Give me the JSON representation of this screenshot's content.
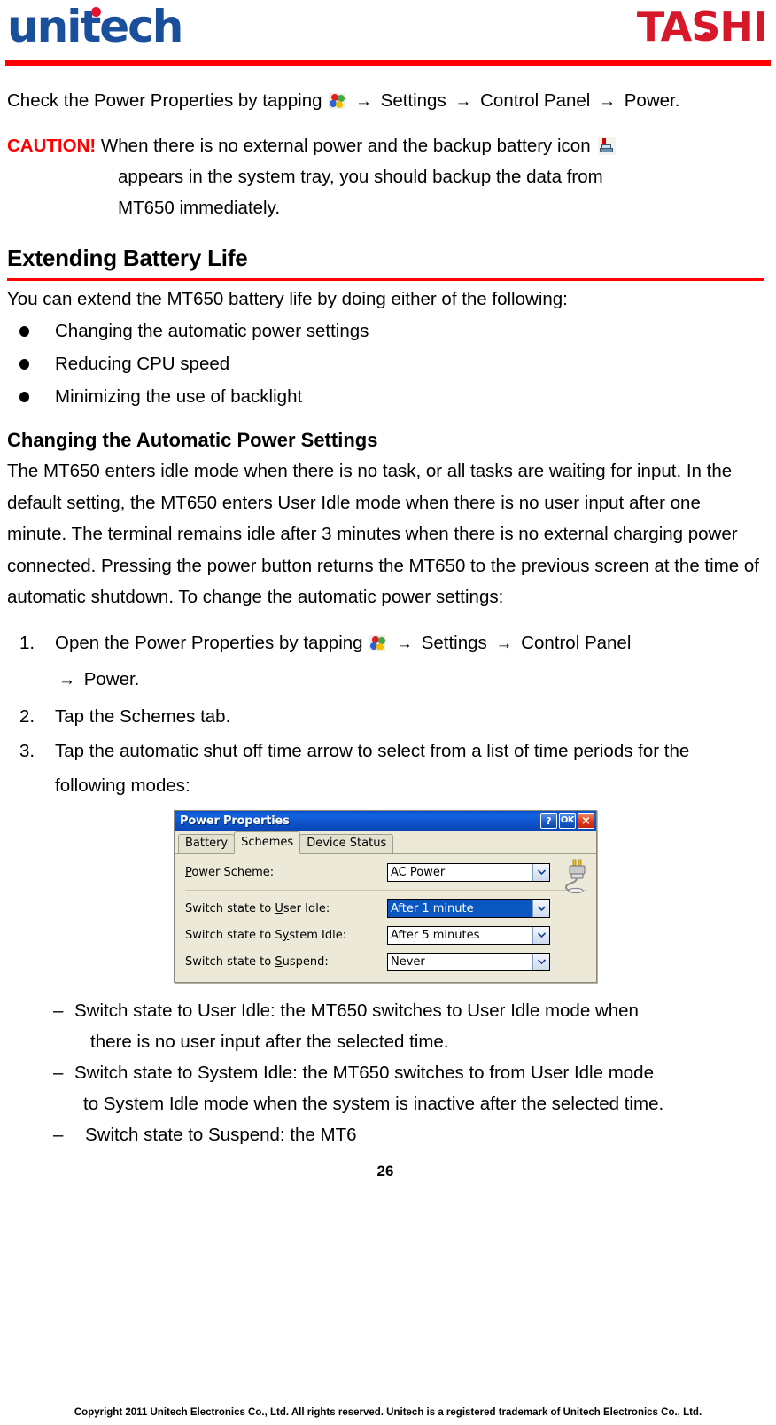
{
  "header": {
    "logo_left": "unitech",
    "logo_right": "TASHI"
  },
  "intro": {
    "text_before_icon": "Check the Power Properties by tapping",
    "start_icon": "windows-start-icon",
    "arrow": "→",
    "menu_settings": "Settings",
    "menu_control_panel": "Control Panel",
    "menu_power": "Power."
  },
  "caution": {
    "label": "CAUTION!",
    "line1": "When there is no external power and the backup battery icon",
    "battery_icon": "backup-battery-warning-icon",
    "line2": "appears in the system tray, you should backup the data from",
    "line3": "MT650 immediately."
  },
  "section": {
    "title": "Extending Battery Life",
    "intro": "You can extend the MT650 battery life by doing either of the following:",
    "bullets": [
      "Changing the automatic power settings",
      "Reducing CPU speed",
      "Minimizing the use of backlight"
    ]
  },
  "subsection": {
    "title": "Changing the Automatic Power Settings",
    "paragraph": "The MT650 enters idle mode when there is no task, or all tasks are waiting for input. In the default setting, the MT650 enters User Idle mode when there is no user input after one minute. The terminal remains idle after 3 minutes when there is no external charging power connected. Pressing the power button returns the MT650 to the previous screen at the time of automatic shutdown. To change the automatic power settings:"
  },
  "steps": [
    {
      "num": "1.",
      "text_before_icon": "Open the Power Properties by tapping",
      "menu_settings": "Settings",
      "menu_control_panel": "Control Panel",
      "continuation": "Power."
    },
    {
      "num": "2.",
      "text": "Tap the Schemes tab."
    },
    {
      "num": "3.",
      "text": "Tap the automatic shut off time arrow to select from a list of time periods for the following modes:"
    }
  ],
  "dialog": {
    "title": "Power Properties",
    "titlebar_buttons": [
      {
        "name": "help-button",
        "label": "?"
      },
      {
        "name": "ok-button",
        "label": "OK"
      },
      {
        "name": "close-button",
        "label": "×"
      }
    ],
    "tabs": [
      {
        "label": "Battery",
        "active": false
      },
      {
        "label": "Schemes",
        "active": true
      },
      {
        "label": "Device Status",
        "active": false
      }
    ],
    "rows": [
      {
        "label_pre": "P",
        "label_key": "o",
        "label_post": "wer Scheme:",
        "value": "AC Power",
        "selected": false
      },
      {
        "label_pre": "Switch state to ",
        "label_key": "U",
        "label_post": "ser Idle:",
        "value": "After 1 minute",
        "selected": true
      },
      {
        "label_pre": "Switch state to S",
        "label_key": "y",
        "label_post": "stem Idle:",
        "value": "After 5 minutes",
        "selected": false
      },
      {
        "label_pre": "Switch state to ",
        "label_key": "S",
        "label_post": "uspend:",
        "value": "Never",
        "selected": false
      }
    ],
    "plug_icon": "power-plug-icon"
  },
  "mode_notes": [
    {
      "dash": "–",
      "line1": "Switch state to User Idle: the MT650 switches to User Idle mode when",
      "line2": "there is no user input after the selected time."
    },
    {
      "dash": "–",
      "line1": "Switch state to System Idle: the MT650 switches to from User Idle mode",
      "line2": "to System Idle mode when the system is inactive after the selected time."
    },
    {
      "dash": "–",
      "line1": "Switch state to Suspend: the MT6",
      "line2": ""
    }
  ],
  "page_number": "26",
  "footer": "Copyright 2011 Unitech Electronics Co., Ltd. All rights reserved. Unitech is a registered trademark of Unitech Electronics Co., Ltd.",
  "colors": {
    "brand_red": "#ff0000",
    "unitech_blue": "#1a4f9c",
    "tashi_red": "#d7182a",
    "dialog_title_blue": "#0d53cc",
    "select_highlight": "#0a57c2"
  }
}
